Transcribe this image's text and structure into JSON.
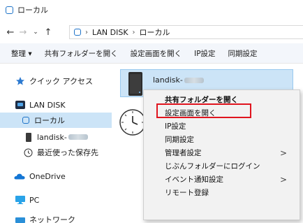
{
  "window": {
    "title": "ローカル"
  },
  "address": {
    "segments": [
      "LAN DISK",
      "ローカル"
    ]
  },
  "toolbar": {
    "items": [
      "整理 ▾",
      "共有フォルダーを開く",
      "設定画面を開く",
      "IP設定",
      "同期設定"
    ]
  },
  "sidebar": {
    "items": [
      {
        "label": "クイック アクセス"
      },
      {
        "label": "LAN DISK"
      },
      {
        "label": "ローカル"
      },
      {
        "label": "landisk-"
      },
      {
        "label": "最近使った保存先"
      },
      {
        "label": "OneDrive"
      },
      {
        "label": "PC"
      },
      {
        "label": "ネットワーク"
      }
    ]
  },
  "content": {
    "tile_label": "landisk-"
  },
  "context_menu": {
    "items": [
      {
        "label": "共有フォルダーを開く",
        "bold": true,
        "submenu": false
      },
      {
        "label": "設定画面を開く",
        "bold": false,
        "submenu": false,
        "highlighted": true
      },
      {
        "label": "IP設定",
        "bold": false,
        "submenu": false
      },
      {
        "label": "同期設定",
        "bold": false,
        "submenu": false
      },
      {
        "label": "管理者設定",
        "bold": false,
        "submenu": true
      },
      {
        "label": "じぶんフォルダーにログイン",
        "bold": false,
        "submenu": false
      },
      {
        "label": "イベント通知設定",
        "bold": false,
        "submenu": true
      },
      {
        "label": "リモート登録",
        "bold": false,
        "submenu": false
      }
    ],
    "arrow_glyph": ">"
  },
  "colors": {
    "accent": "#1e73c8",
    "highlight_box": "#e0141e",
    "selection": "#cce4f7"
  }
}
